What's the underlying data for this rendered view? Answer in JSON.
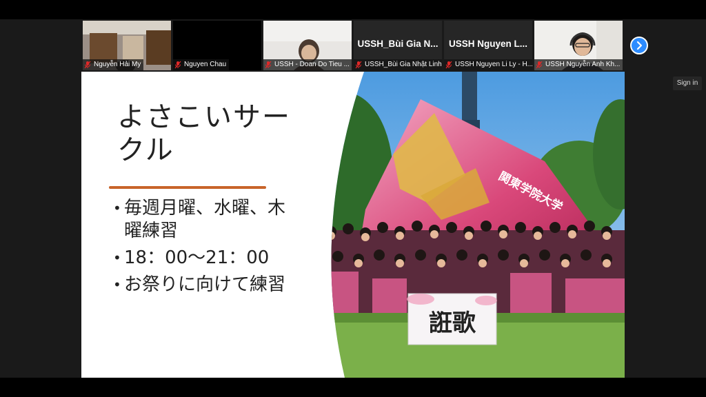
{
  "participants": [
    {
      "label": "Nguyễn Hải My",
      "muted": true
    },
    {
      "label": "Nguyen Chau",
      "muted": true
    },
    {
      "label": "USSH - Doan Do Tieu ...",
      "muted": true
    },
    {
      "big_name": "USSH_Bùi Gia N...",
      "label": "USSH_Bùi Gia Nhật Linh",
      "muted": true
    },
    {
      "big_name": "USSH Nguyen L...",
      "label": "USSH Nguyen Li Ly - H...",
      "muted": true
    },
    {
      "label": "USSH Nguyễn Anh Kh...",
      "muted": true
    }
  ],
  "sign_in": "Sign in",
  "slide": {
    "title": "よさこいサークル",
    "bullets": [
      "毎週月曜、水曜、木曜練習",
      "18：00～21：00",
      "お祭りに向けて練習"
    ],
    "accent_color": "#c8642a",
    "photo_sign_text": "関東学院大学",
    "photo_banner_text": "誑歌"
  },
  "colors": {
    "zoom_blue": "#2d8cff",
    "mute_red": "#e02828"
  }
}
